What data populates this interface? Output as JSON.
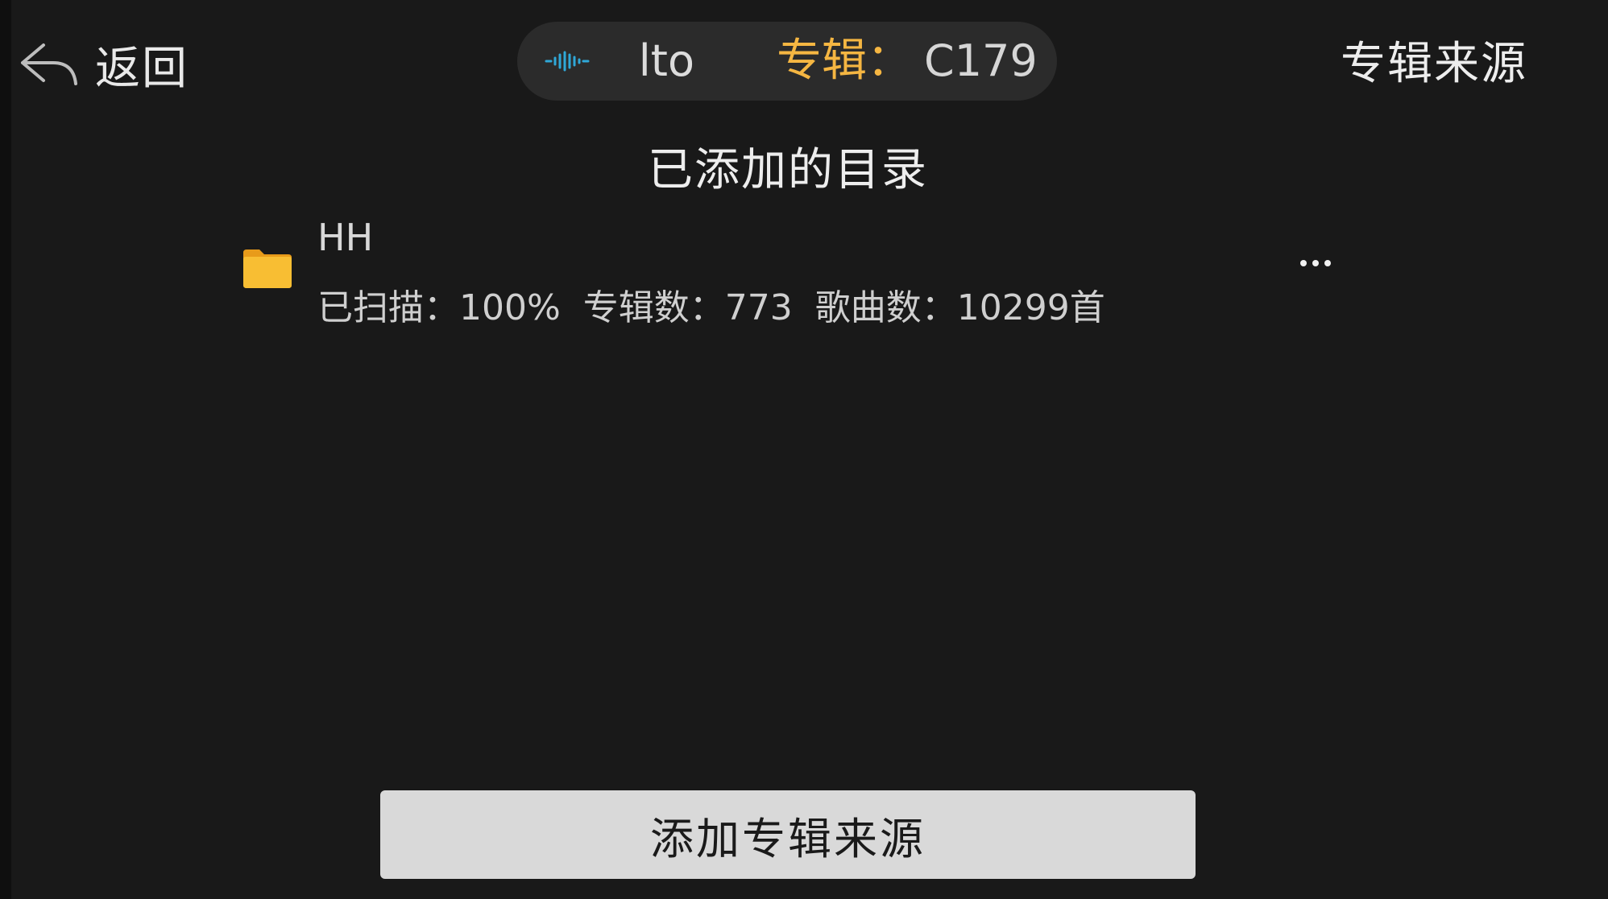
{
  "header": {
    "back_label": "返回",
    "title": "专辑来源"
  },
  "now_playing": {
    "track_fragment": "lto",
    "album_label": "专辑：",
    "album_value": "C179",
    "wave_color": "#2fa8d8",
    "album_label_color": "#f5b642"
  },
  "section": {
    "title": "已添加的目录"
  },
  "directories": [
    {
      "name": "HH",
      "scanned": "已扫描：100%",
      "albums": "专辑数：773",
      "songs": "歌曲数：10299首",
      "icon": "folder-icon",
      "icon_color": "#f5b731"
    }
  ],
  "footer": {
    "add_button_label": "添加专辑来源"
  }
}
